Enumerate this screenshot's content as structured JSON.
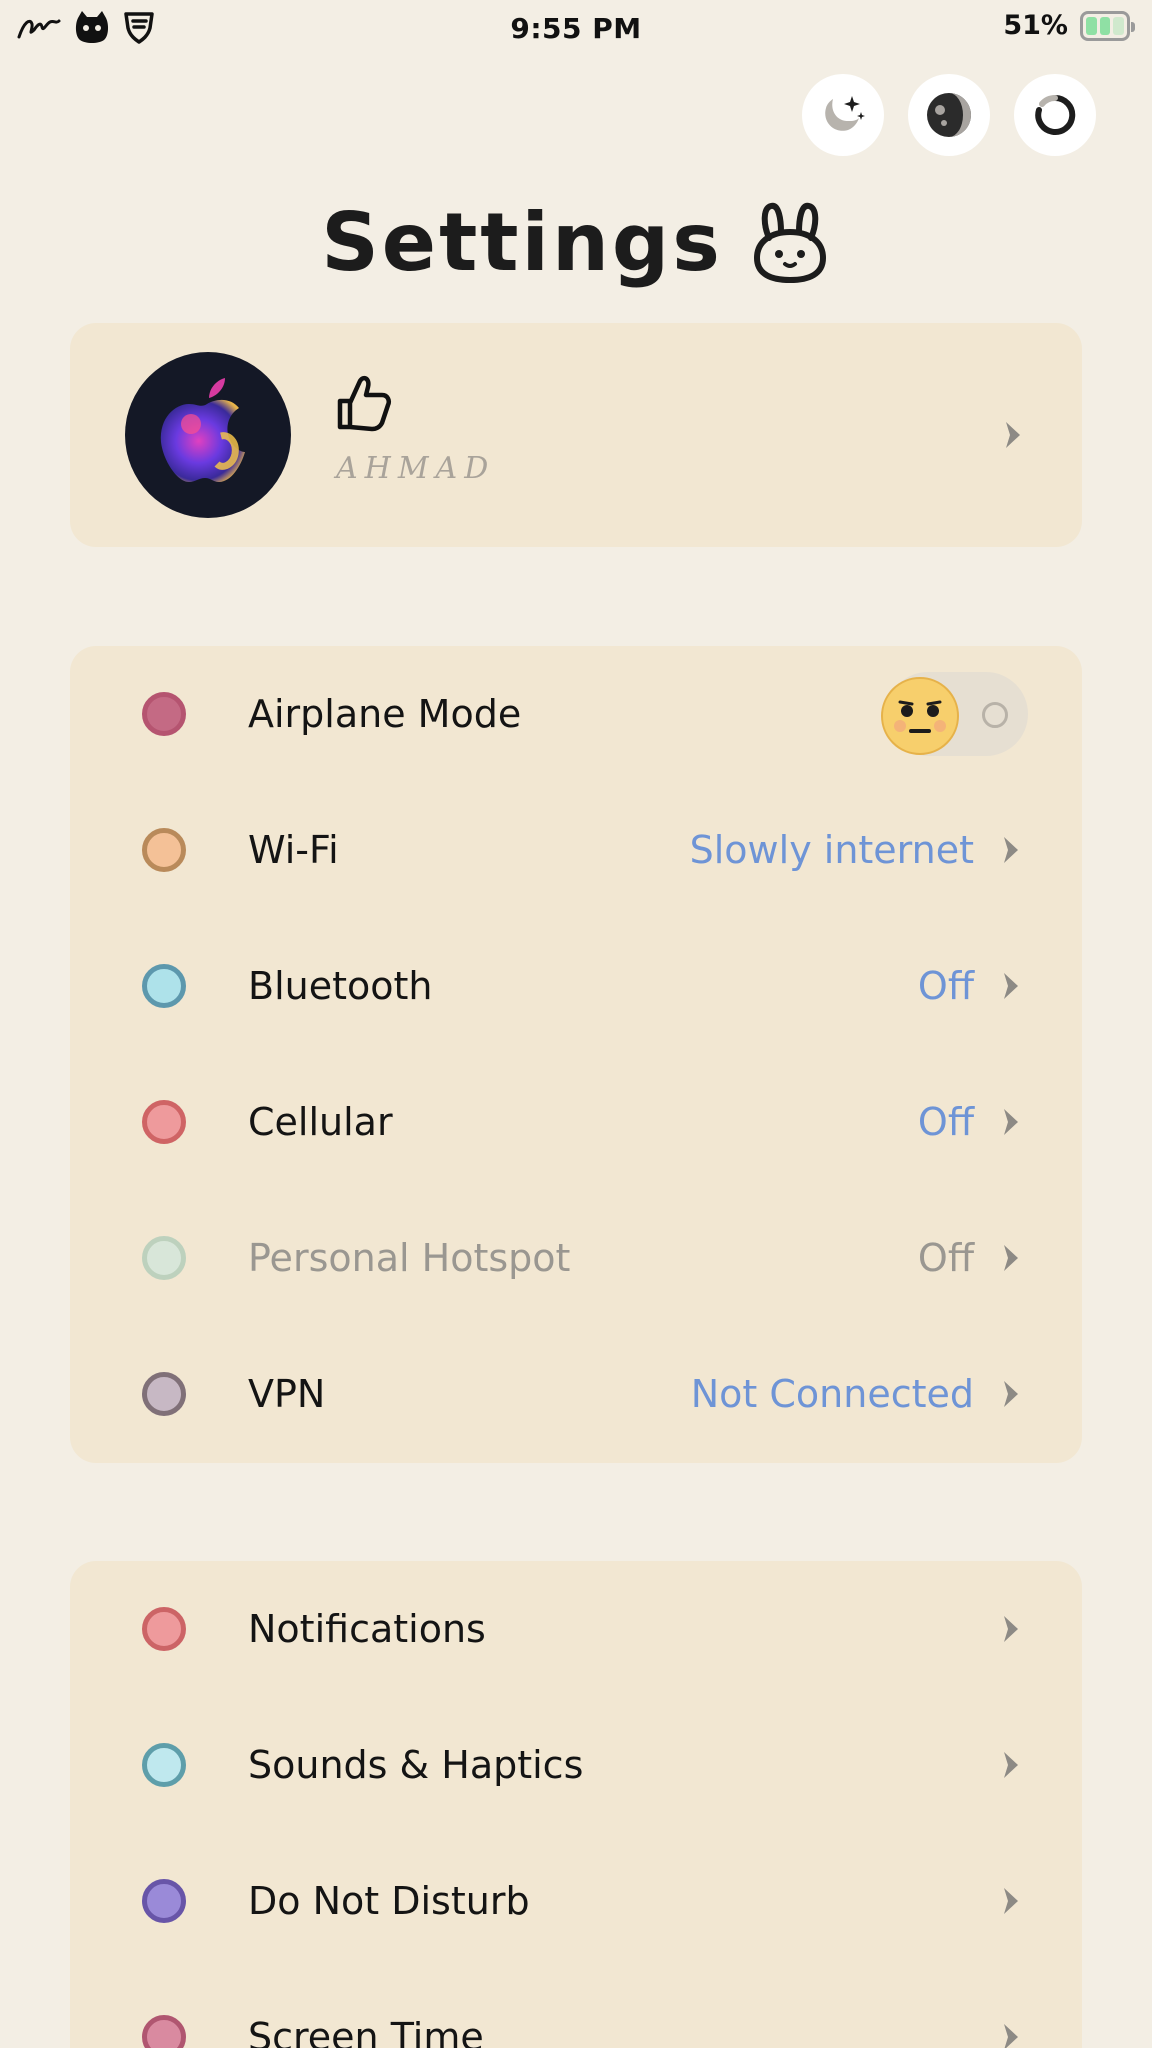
{
  "status_bar": {
    "time": "9:55 PM",
    "battery_percent": "51%",
    "battery_level": 0.51,
    "left_icons": [
      "signature-icon",
      "cat-icon",
      "shield-logo-icon"
    ]
  },
  "top_buttons": [
    {
      "name": "moon-stars-button",
      "icon": "moon-stars-icon"
    },
    {
      "name": "theme-button",
      "icon": "half-moon-icon"
    },
    {
      "name": "refresh-button",
      "icon": "refresh-icon"
    }
  ],
  "header": {
    "title": "Settings",
    "title_icon": "bunny-icon"
  },
  "profile": {
    "name": "AHMAD",
    "avatar_icon": "apple-logo-icon",
    "badge_icon": "thumbs-up-icon"
  },
  "connectivity": {
    "items": [
      {
        "label": "Airplane Mode",
        "value": "",
        "dot_color": "#c46a84",
        "dot_border": "#b55470",
        "toggle": true,
        "toggle_on": false
      },
      {
        "label": "Wi-Fi",
        "value": "Slowly internet",
        "dot_color": "#f4c197",
        "dot_border": "#b98a5a"
      },
      {
        "label": "Bluetooth",
        "value": "Off",
        "dot_color": "#aee2ea",
        "dot_border": "#5d98ad"
      },
      {
        "label": "Cellular",
        "value": "Off",
        "dot_color": "#ee9a9c",
        "dot_border": "#cf6465"
      },
      {
        "label": "Personal Hotspot",
        "value": "Off",
        "dot_color": "#d8e6d9",
        "dot_border": "#bdd1bd",
        "dimmed": true
      },
      {
        "label": "VPN",
        "value": "Not Connected",
        "dot_color": "#c7b8c4",
        "dot_border": "#807078"
      }
    ]
  },
  "general": {
    "items": [
      {
        "label": "Notifications",
        "dot_color": "#ee9a9c",
        "dot_border": "#cc6466"
      },
      {
        "label": "Sounds & Haptics",
        "dot_color": "#bfe8ee",
        "dot_border": "#5e9eaa"
      },
      {
        "label": "Do Not Disturb",
        "dot_color": "#9a8ad8",
        "dot_border": "#6855a8"
      },
      {
        "label": "Screen Time",
        "dot_color": "#d98aa0",
        "dot_border": "#b05670"
      }
    ]
  },
  "colors": {
    "background": "#f3eee4",
    "card": "#f2e7d2",
    "value_text": "#6e94d6"
  }
}
